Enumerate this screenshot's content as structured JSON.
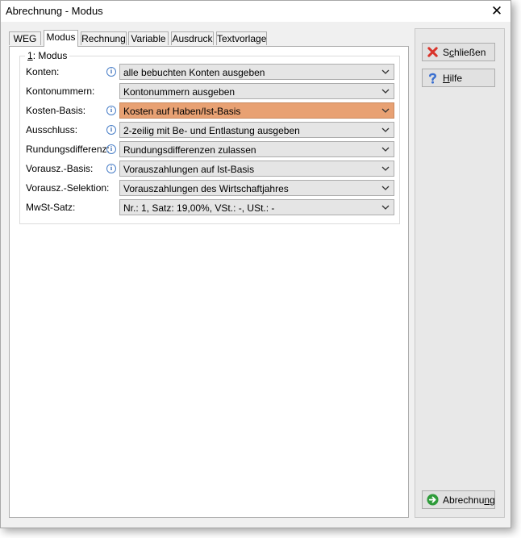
{
  "window": {
    "title": "Abrechnung - Modus",
    "close_glyph": "✕"
  },
  "tabs": [
    {
      "label": "WEG",
      "active": false
    },
    {
      "label": "Modus",
      "active": true
    },
    {
      "label": "Rechnung",
      "active": false
    },
    {
      "label": "Variable",
      "active": false
    },
    {
      "label": "Ausdruck",
      "active": false
    },
    {
      "label": "Textvorlage",
      "active": false
    }
  ],
  "group": {
    "title_num": "1",
    "title_text": ": Modus"
  },
  "rows": [
    {
      "label": "Konten:",
      "info": true,
      "value": "alle bebuchten Konten ausgeben",
      "highlight": false
    },
    {
      "label": "Kontonummern:",
      "info": false,
      "value": "Kontonummern ausgeben",
      "highlight": false
    },
    {
      "label": "Kosten-Basis:",
      "info": true,
      "value": "Kosten auf Haben/Ist-Basis",
      "highlight": true
    },
    {
      "label": "Ausschluss:",
      "info": true,
      "value": "2-zeilig mit Be- und Entlastung ausgeben",
      "highlight": false
    },
    {
      "label": "Rundungsdifferenz:",
      "info": true,
      "value": "Rundungsdifferenzen zulassen",
      "highlight": false
    },
    {
      "label": "Vorausz.-Basis:",
      "info": true,
      "value": "Vorauszahlungen auf Ist-Basis",
      "highlight": false
    },
    {
      "label": "Vorausz.-Selektion:",
      "info": false,
      "value": "Vorauszahlungen des Wirtschaftjahres",
      "highlight": false
    },
    {
      "label": "MwSt-Satz:",
      "info": false,
      "value": "Nr.: 1,  Satz: 19,00%,  VSt.: -,  USt.: -",
      "highlight": false
    }
  ],
  "info_glyph": "i",
  "side_buttons": {
    "close": {
      "pre": "S",
      "ul": "c",
      "post": "hließen",
      "icon": "red-x-icon"
    },
    "help": {
      "pre": "",
      "ul": "H",
      "post": "ilfe",
      "icon": "question-icon"
    },
    "run": {
      "pre": "Abrechnu",
      "ul": "n",
      "post": "g",
      "icon": "green-arrow-icon"
    }
  },
  "colors": {
    "highlight": "#e8a173",
    "accent_blue": "#2f63b1"
  }
}
